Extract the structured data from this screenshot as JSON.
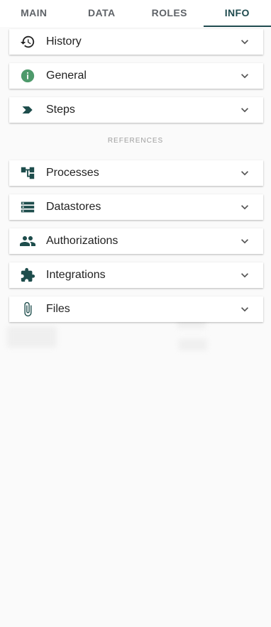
{
  "tabs": [
    {
      "label": "MAIN",
      "active": false
    },
    {
      "label": "DATA",
      "active": false
    },
    {
      "label": "ROLES",
      "active": false
    },
    {
      "label": "INFO",
      "active": true
    }
  ],
  "panels_top": [
    {
      "label": "History",
      "icon": "history-icon"
    },
    {
      "label": "General",
      "icon": "info-icon"
    },
    {
      "label": "Steps",
      "icon": "step-icon"
    }
  ],
  "section_header": "REFERENCES",
  "panels_references": [
    {
      "label": "Processes",
      "icon": "process-tree-icon"
    },
    {
      "label": "Datastores",
      "icon": "datastore-icon"
    },
    {
      "label": "Authorizations",
      "icon": "people-icon"
    },
    {
      "label": "Integrations",
      "icon": "puzzle-icon"
    },
    {
      "label": "Files",
      "icon": "paperclip-icon"
    }
  ],
  "colors": {
    "accent": "#1f4b4f",
    "icon_dark": "#1e4d4c",
    "info_green": "#4e9a6b",
    "chevron": "#555555"
  }
}
